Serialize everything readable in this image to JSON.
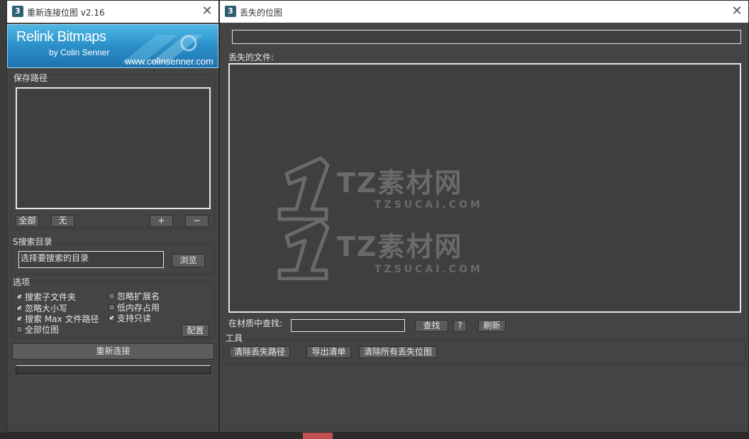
{
  "left_window": {
    "title": "重新连接位图 v2.16",
    "app_icon_label": "3",
    "banner": {
      "title": "Relink Bitmaps",
      "subtitle": "by Colin Senner",
      "url": "www.colinsenner.com"
    },
    "save_paths": {
      "label": "保存路径",
      "buttons": {
        "all": "全部",
        "none": "无",
        "add": "+",
        "remove": "−"
      }
    },
    "search_dir": {
      "label": "S搜索目录",
      "input_value": "选择要搜索的目录",
      "browse": "浏览"
    },
    "options": {
      "label": "选项",
      "items": [
        {
          "label": "搜索子文件夹",
          "checked": true
        },
        {
          "label": "忽略扩展名",
          "checked": false
        },
        {
          "label": "忽略大小写",
          "checked": true
        },
        {
          "label": "低内存占用",
          "checked": false
        },
        {
          "label": "搜索 Max 文件路径",
          "checked": true
        },
        {
          "label": "支持只读",
          "checked": true
        },
        {
          "label": "全部位图",
          "checked": false
        }
      ],
      "config": "配置"
    },
    "relink_button": "重新连接"
  },
  "right_window": {
    "title": "丢失的位图",
    "app_icon_label": "3",
    "missing_files_label": "丢失的文件:",
    "find": {
      "label": "在材质中查找:",
      "find_button": "查找",
      "help_button": "?",
      "refresh_button": "刷新"
    },
    "tools": {
      "label": "工具",
      "buttons": [
        "清除丢失路径",
        "导出清单",
        "清除所有丢失位图"
      ]
    }
  },
  "watermark": {
    "text": "TZ素材网",
    "sub": "TZSUCAI.COM"
  },
  "colors": {
    "panel_bg": "#444444",
    "titlebar_bg": "#ffffff",
    "banner_blue": "#2b8fc8",
    "taskbar_accent": "#c05050"
  }
}
